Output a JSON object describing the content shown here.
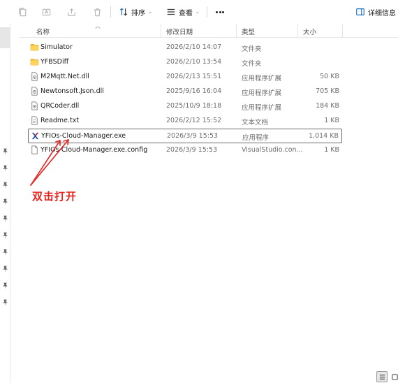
{
  "toolbar": {
    "sort_label": "排序",
    "view_label": "查看",
    "details_label": "详细信息",
    "icons": [
      "copy-icon",
      "rename-icon",
      "share-icon",
      "delete-icon"
    ]
  },
  "columns": {
    "name": "名称",
    "date": "修改日期",
    "type": "类型",
    "size": "大小"
  },
  "files": [
    {
      "name": "Simulator",
      "date": "2026/2/10 14:07",
      "type": "文件夹",
      "size": "",
      "icon": "folder-icon"
    },
    {
      "name": "YFBSDiff",
      "date": "2026/2/10 13:54",
      "type": "文件夹",
      "size": "",
      "icon": "folder-icon"
    },
    {
      "name": "M2Mqtt.Net.dll",
      "date": "2026/2/13 15:51",
      "type": "应用程序扩展",
      "size": "50 KB",
      "icon": "dll-icon"
    },
    {
      "name": "Newtonsoft.Json.dll",
      "date": "2025/9/16 16:04",
      "type": "应用程序扩展",
      "size": "705 KB",
      "icon": "dll-icon"
    },
    {
      "name": "QRCoder.dll",
      "date": "2025/10/9 18:18",
      "type": "应用程序扩展",
      "size": "184 KB",
      "icon": "dll-icon"
    },
    {
      "name": "Readme.txt",
      "date": "2026/2/12 15:52",
      "type": "文本文档",
      "size": "1 KB",
      "icon": "text-file-icon"
    },
    {
      "name": "YFIOs-Cloud-Manager.exe",
      "date": "2026/3/9 15:53",
      "type": "应用程序",
      "size": "1,014 KB",
      "icon": "app-exe-icon",
      "selected": true
    },
    {
      "name": "YFIOs-Cloud-Manager.exe.config",
      "date": "2026/3/9 15:53",
      "type": "VisualStudio.con...",
      "size": "1 KB",
      "icon": "config-file-icon"
    }
  ],
  "annotation": {
    "text": "双击打开",
    "color": "#e8231f"
  },
  "colors": {
    "folder": "#f5c040",
    "annotation": "#e8231f",
    "selection_border": "#6b6b6b"
  }
}
